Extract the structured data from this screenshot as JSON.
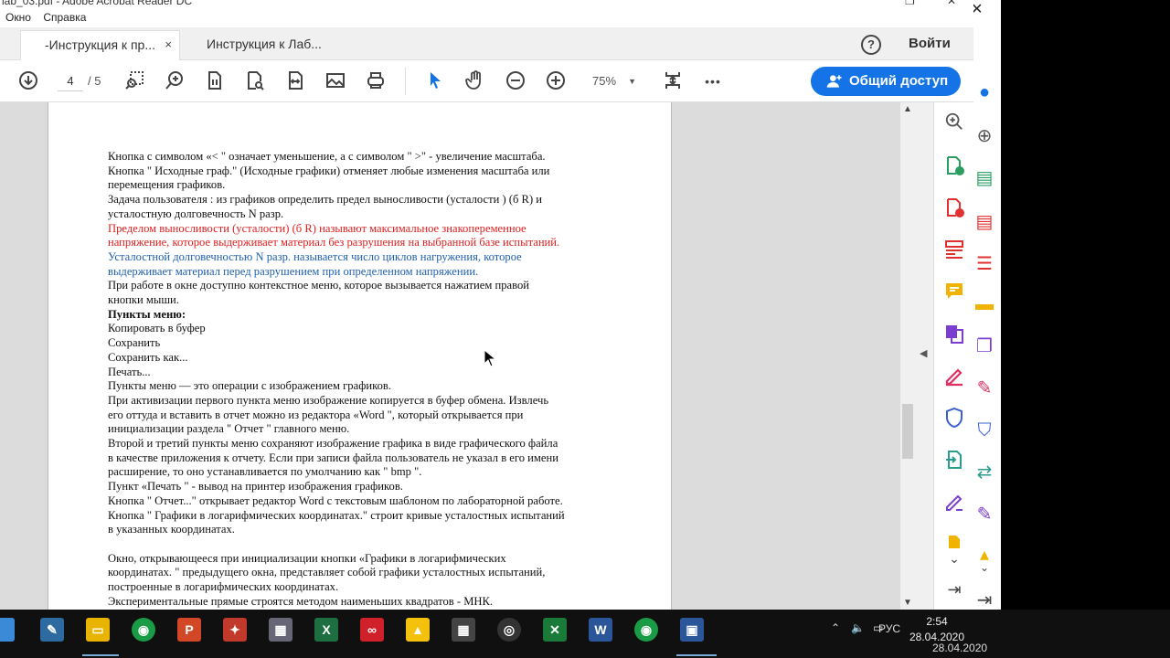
{
  "window": {
    "title": "lab_03.pdf - Adobe Acrobat Reader DC",
    "minimize": "—",
    "restore": "❐",
    "close": "✕"
  },
  "menu": [
    "Окно",
    "Справка"
  ],
  "tabs": [
    {
      "label": "-Инструкция к пр...",
      "close": "×"
    },
    {
      "label": "Инструкция к Лаб..."
    }
  ],
  "header": {
    "help": "?",
    "signin": "Войти"
  },
  "toolbar": {
    "page_current": "4",
    "page_total": "/   5",
    "zoom": "75%",
    "more": "•••",
    "share_label": "Общий доступ"
  },
  "document": {
    "lines": [
      {
        "text": "       Кнопка с символом «< \" означает уменьшение, а с  символом \" >\" - увеличение масштаба.",
        "style": ""
      },
      {
        "text": "Кнопка \" Исходные граф.\" (Исходные графики) отменяет любые изменения масштаба или",
        "style": ""
      },
      {
        "text": "перемещения графиков.",
        "style": ""
      },
      {
        "text": "       Задача пользователя : из графиков определить предел  выносливости (усталости ) (б R)  и",
        "style": ""
      },
      {
        "text": "усталостную долговечность N разр.",
        "style": ""
      },
      {
        "text": "       Пределом выносливости (усталости) (б R) называют максимальное знакопеременное",
        "style": "red"
      },
      {
        "text": "напряжение, которое выдерживает материал без разрушения на выбранной базе испытаний.",
        "style": "red"
      },
      {
        "text": "       Усталостной долговечностью N разр. называется число циклов нагружения, которое",
        "style": "blue"
      },
      {
        "text": "выдерживает материал перед разрушением при определенном напряжении.",
        "style": "blue"
      },
      {
        "text": "       При работе в окне доступно контекстное меню, которое вызывается нажатием правой",
        "style": ""
      },
      {
        "text": "кнопки мыши.",
        "style": ""
      },
      {
        "text": "       Пункты меню:",
        "style": "bold"
      },
      {
        "text": "       Копировать в буфер",
        "style": ""
      },
      {
        "text": "       Сохранить",
        "style": ""
      },
      {
        "text": "       Сохранить как...",
        "style": ""
      },
      {
        "text": "       Печать...",
        "style": ""
      },
      {
        "text": "       Пункты меню — это операции с изображением графиков.",
        "style": ""
      },
      {
        "text": "       При активизации первого пункта меню изображение копируется в буфер обмена. Извлечь",
        "style": ""
      },
      {
        "text": "его оттуда и вставить в отчет можно из редактора «Word \", который открывается при",
        "style": ""
      },
      {
        "text": "инициализации раздела \" Отчет \" главного меню.",
        "style": ""
      },
      {
        "text": "       Второй и третий пункты меню сохраняют изображение графика в виде графического файла",
        "style": ""
      },
      {
        "text": "в качестве приложения к отчету. Если при записи файла пользователь не указал в его имени",
        "style": ""
      },
      {
        "text": "расширение, то оно устанавливается по умолчанию как \" bmp \".",
        "style": ""
      },
      {
        "text": "      Пункт «Печать \" - вывод на принтер изображения графиков.",
        "style": ""
      },
      {
        "text": "      Кнопка \" Отчет...\" открывает редактор Word с текстовым шаблоном по лабораторной работе.",
        "style": ""
      },
      {
        "text": "      Кнопка \" Графики в логарифмических координатах.\" строит кривые усталостных испытаний",
        "style": ""
      },
      {
        "text": "в указанных координатах.",
        "style": ""
      },
      {
        "text": "",
        "style": ""
      },
      {
        "text": "      Окно, открывающееся при инициализации кнопки «Графики в логарифмических",
        "style": ""
      },
      {
        "text": "координатах. \" предыдущего окна, представляет собой графики усталостных испытаний,",
        "style": ""
      },
      {
        "text": "построенные в логарифмических координатах.",
        "style": ""
      },
      {
        "text": "      Экспериментальные прямые строятся методом наименьших квадратов - МНК.",
        "style": ""
      }
    ]
  },
  "taskbar": {
    "tray_lang": "РУС",
    "time": "2:54",
    "date": "28.04.2020",
    "date_ghost": "28.04.2020"
  },
  "colors": {
    "accent": "#1473e6",
    "red_text": "#e02020",
    "blue_text": "#2060b0"
  }
}
